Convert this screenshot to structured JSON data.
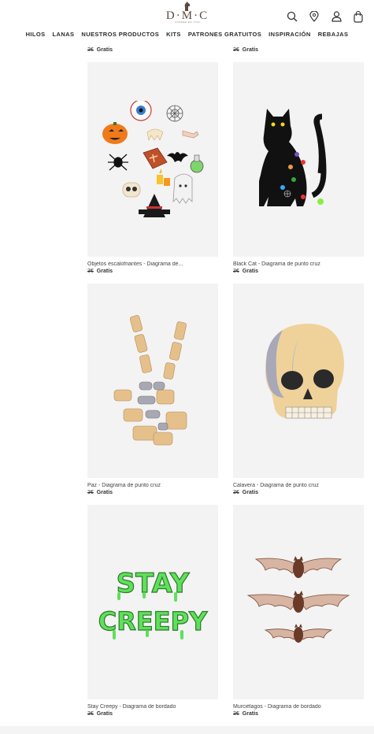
{
  "brand": {
    "name": "D·M·C",
    "tagline": "FONDÉE EN 1746"
  },
  "nav": [
    "HILOS",
    "LANAS",
    "NUESTROS PRODUCTOS",
    "KITS",
    "PATRONES GRATUITOS",
    "INSPIRACIÓN",
    "REBAJAS"
  ],
  "header_icons": [
    "search-icon",
    "location-icon",
    "account-icon",
    "cart-icon"
  ],
  "top_prices": [
    {
      "old": "3€",
      "new": "Gratis"
    },
    {
      "old": "3€",
      "new": "Gratis"
    }
  ],
  "products": [
    {
      "name": "Objetos escalofriantes - Diagrama de...",
      "old_price": "3€",
      "price": "Gratis"
    },
    {
      "name": "Black Cat - Diagrama de punto cruz",
      "old_price": "3€",
      "price": "Gratis"
    },
    {
      "name": "Paz - Diagrama de punto cruz",
      "old_price": "3€",
      "price": "Gratis"
    },
    {
      "name": "Calavera - Diagrama de punto cruz",
      "old_price": "3€",
      "price": "Gratis"
    },
    {
      "name": "Stay Creepy - Diagrama de bordado",
      "old_price": "3€",
      "price": "Gratis"
    },
    {
      "name": "Murciélagos - Diagrama de bordado",
      "old_price": "3€",
      "price": "Gratis"
    }
  ],
  "artwork_text": {
    "stay": "STAY",
    "creepy": "CREEPY"
  },
  "colors": {
    "brand": "#5a4a3f",
    "tile_bg": "#f3f3f3",
    "slime_green": "#5fe05a"
  }
}
